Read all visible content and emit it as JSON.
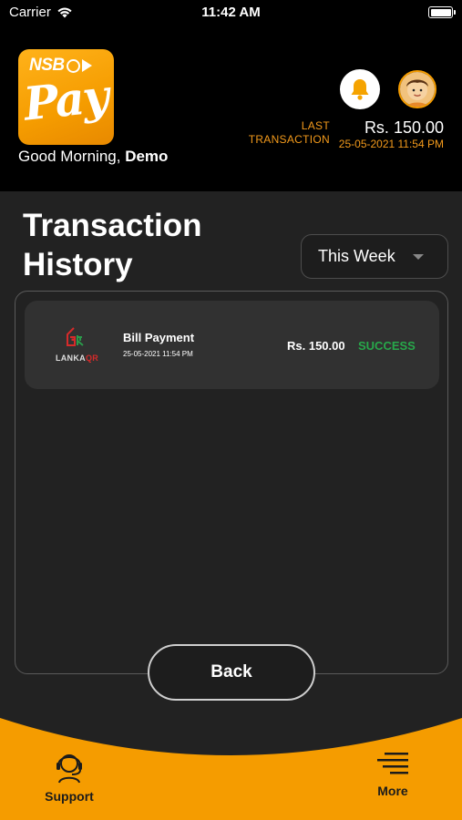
{
  "status_bar": {
    "carrier": "Carrier",
    "time": "11:42 AM"
  },
  "header": {
    "logo": {
      "brand": "NSB",
      "script": "Pay"
    },
    "greeting_prefix": "Good Morning,",
    "user_name": "Demo",
    "last_transaction": {
      "label_line1": "LAST",
      "label_line2": "TRANSACTION",
      "amount": "Rs. 150.00",
      "datetime": "25-05-2021 11:54 PM"
    },
    "icons": {
      "notification": "bell-icon",
      "profile": "avatar-icon"
    }
  },
  "main": {
    "title_line1": "Transaction",
    "title_line2": "History",
    "filter": {
      "selected": "This Week"
    },
    "transactions": [
      {
        "logo_text_a": "LANKA",
        "logo_text_b": "QR",
        "title": "Bill Payment",
        "datetime": "25-05-2021 11:54 PM",
        "amount": "Rs. 150.00",
        "status": "SUCCESS"
      }
    ],
    "back_label": "Back"
  },
  "bottom_nav": {
    "support_label": "Support",
    "more_label": "More"
  },
  "colors": {
    "accent": "#F59C00",
    "success": "#27A84A",
    "background": "#222222"
  }
}
